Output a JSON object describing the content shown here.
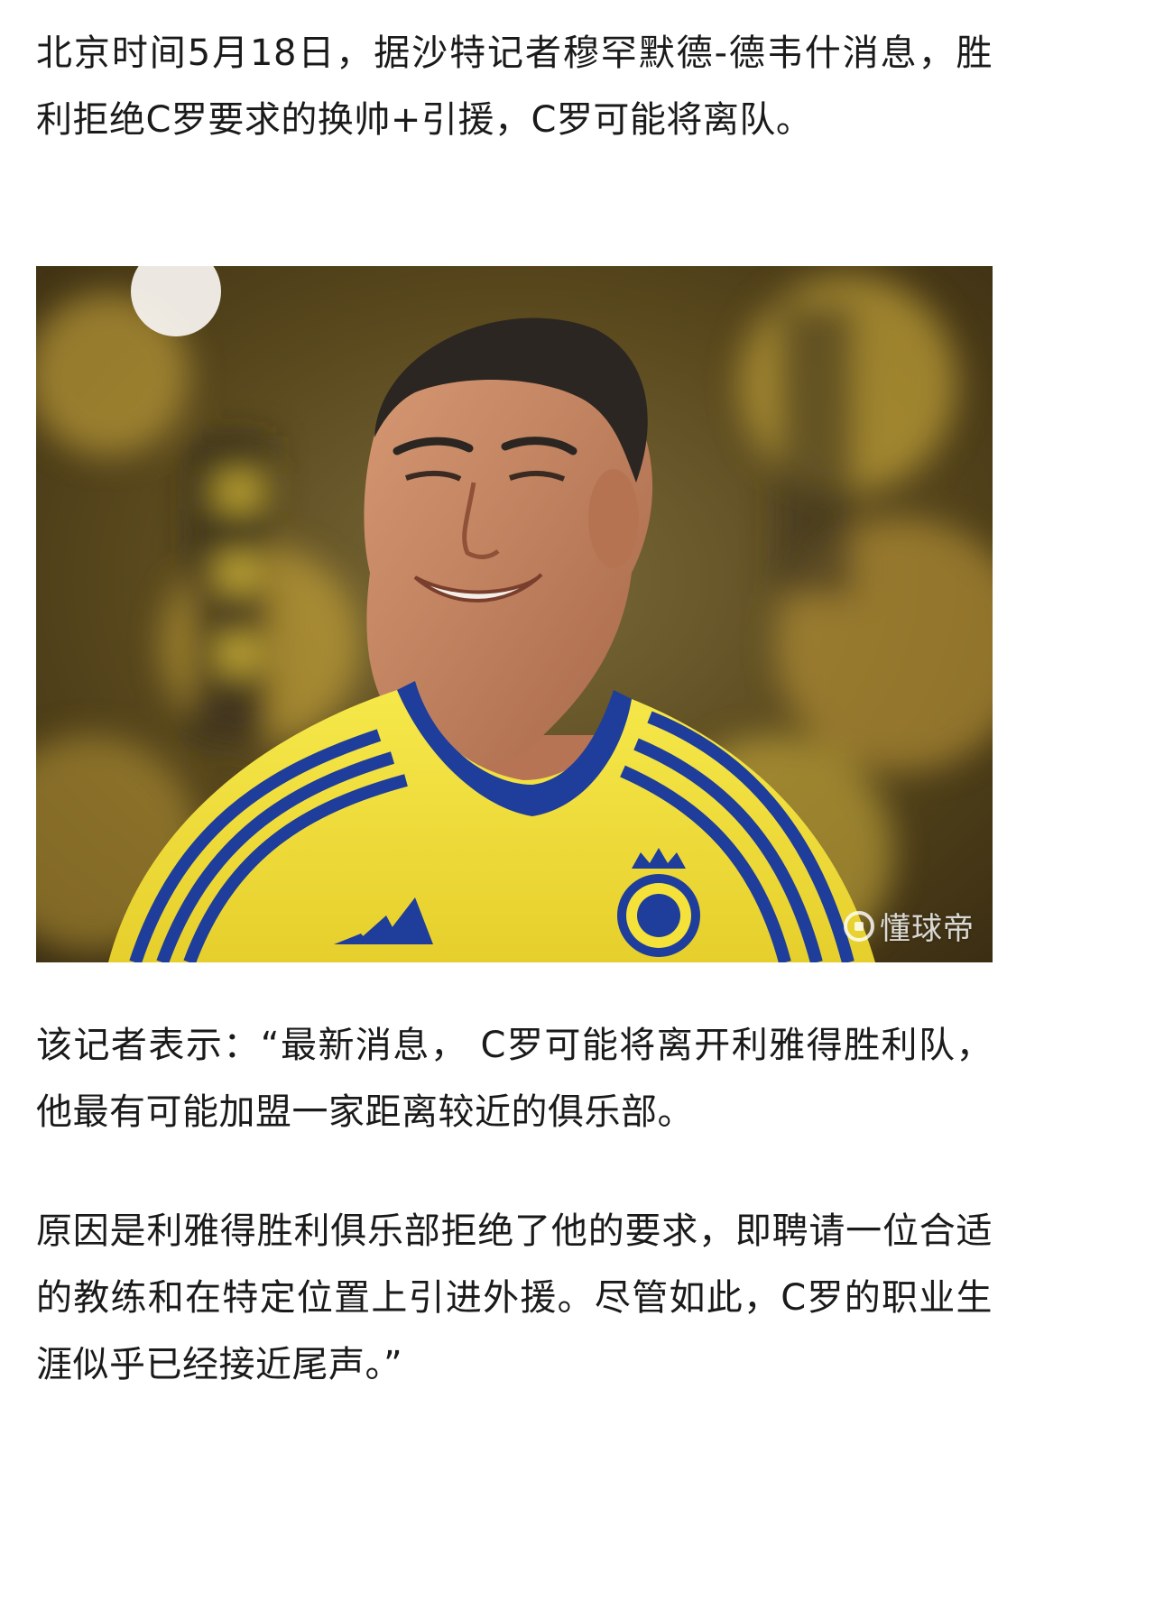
{
  "article": {
    "paragraphs": [
      "北京时间5月18日，据沙特记者穆罕默德-德韦什消息，胜利拒绝C罗要求的换帅+引援，C罗可能将离队。",
      "该记者表示：“最新消息， C罗可能将离开利雅得胜利队，他最有可能加盟一家距离较近的俱乐部。",
      "原因是利雅得胜利俱乐部拒绝了他的要求，即聘请一位合适的教练和在特定位置上引进外援。尽管如此，C罗的职业生涯似乎已经接近尾声。”"
    ]
  },
  "image": {
    "watermark": "懂球帝",
    "jersey_colors": {
      "yellow": "#f4e23a",
      "blue": "#1f3d9a"
    }
  }
}
